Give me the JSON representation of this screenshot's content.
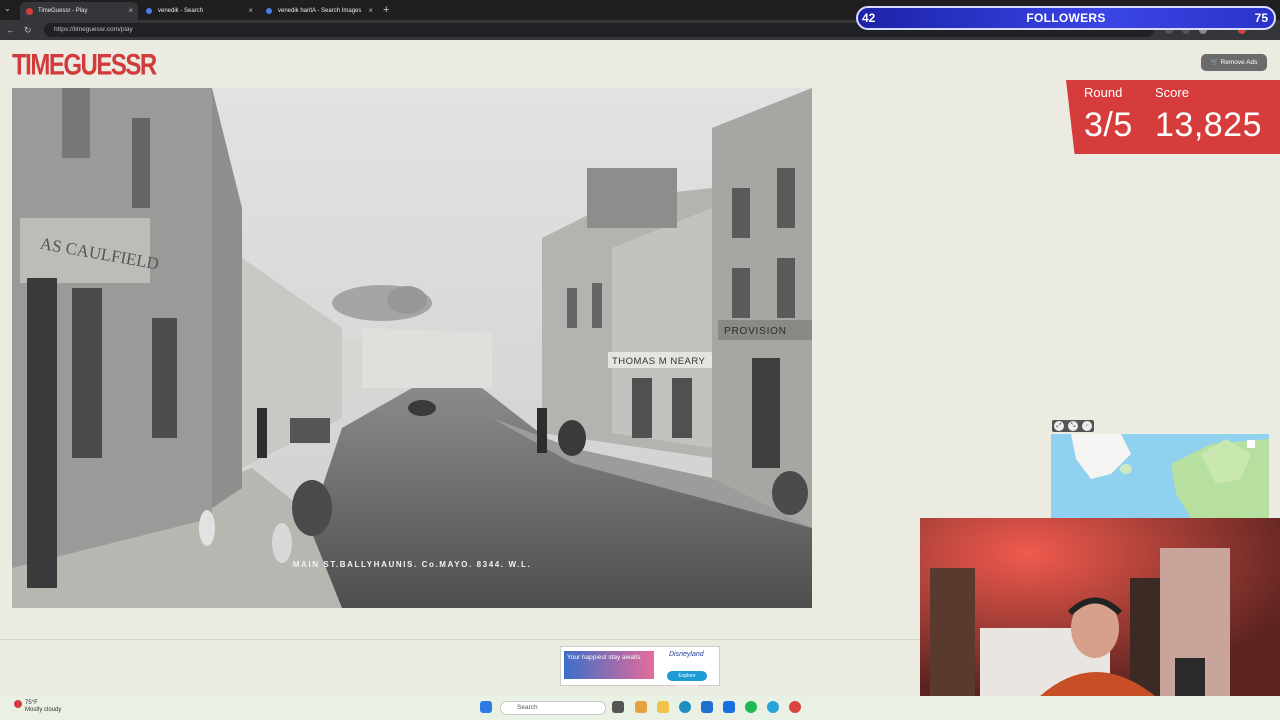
{
  "browser": {
    "tabs": [
      {
        "title": "TimeGuessr - Play",
        "active": true,
        "favicon_color": "#d63c3c"
      },
      {
        "title": "venedik - Search",
        "active": false,
        "favicon_color": "#4a7ee8"
      },
      {
        "title": "venedik haritA - Search Images",
        "active": false,
        "favicon_color": "#4a7ee8"
      }
    ],
    "url": "https://timeguessr.com/play"
  },
  "overlay": {
    "followers_current": "42",
    "followers_label": "FOLLOWERS",
    "followers_goal": "75",
    "progress_fraction": 0.56
  },
  "page": {
    "logo": "TIMEGUESSR",
    "remove_ads_label": "Remove Ads",
    "photo_caption": "MAIN ST.BALLYHAUNIS. Co.MAYO. 8344. W.L.",
    "photo_signs": {
      "left_shop": "AS CAULFIELD",
      "right_shop_1": "THOMAS M NEARY",
      "right_shop_2": "PROVISION"
    },
    "round_label": "Round",
    "round_value": "3/5",
    "score_label": "Score",
    "score_value": "13,825",
    "ad_text": "Your happiest stay awaits",
    "ad_brand": "Disneyland",
    "ad_button": "Explore Packages"
  },
  "taskbar": {
    "temperature": "75°F",
    "weather": "Mostly cloudy",
    "search_placeholder": "Search"
  },
  "colors": {
    "accent": "#d63c3c",
    "page_bg": "#ecebe1"
  }
}
